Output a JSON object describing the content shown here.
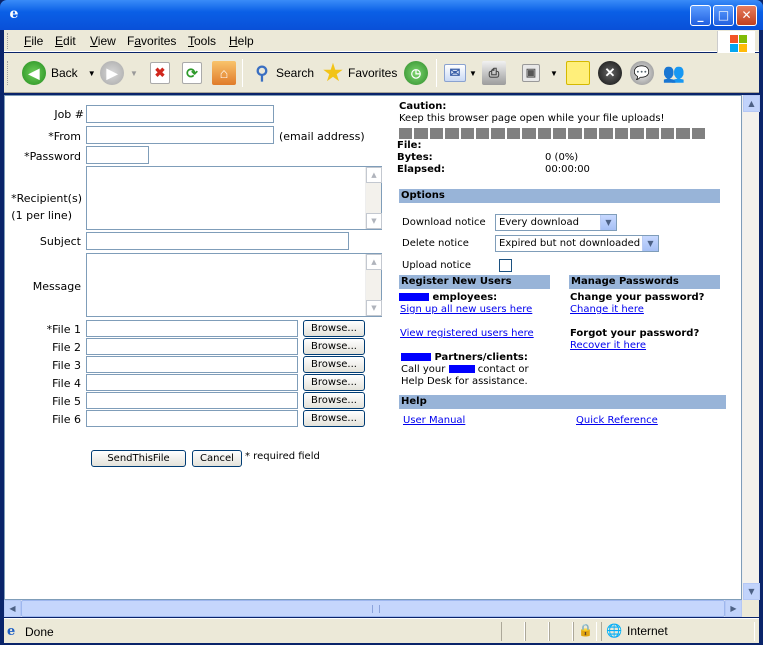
{
  "menu": [
    "File",
    "Edit",
    "View",
    "Favorites",
    "Tools",
    "Help"
  ],
  "menu_accel": [
    "F",
    "E",
    "V",
    "a",
    "T",
    "H"
  ],
  "toolbar": {
    "back": "Back",
    "search": "Search",
    "favorites": "Favorites"
  },
  "form": {
    "job_label": "Job #",
    "from_label": "*From",
    "from_hint": "(email address)",
    "password_label": "*Password",
    "recipients_label": "*Recipient(s)",
    "recipients_hint": "(1 per line)",
    "subject_label": "Subject",
    "message_label": "Message",
    "files": [
      {
        "label": "*File 1",
        "button": "Browse..."
      },
      {
        "label": "File 2",
        "button": "Browse..."
      },
      {
        "label": "File 3",
        "button": "Browse..."
      },
      {
        "label": "File 4",
        "button": "Browse..."
      },
      {
        "label": "File 5",
        "button": "Browse..."
      },
      {
        "label": "File 6",
        "button": "Browse..."
      }
    ],
    "send_button": "SendThisFile",
    "cancel_button": "Cancel",
    "required_note": "* required field"
  },
  "upload": {
    "caution_title": "Caution:",
    "caution_text": "Keep this browser page open while your file uploads!",
    "progress_fraction": 0,
    "file_label": "File:",
    "bytes_label": "Bytes:",
    "bytes_value": "0 (0%)",
    "elapsed_label": "Elapsed:",
    "elapsed_value": "00:00:00"
  },
  "options": {
    "header": "Options",
    "download_label": "Download notice",
    "download_value": "Every download",
    "delete_label": "Delete notice",
    "delete_value": "Expired but not downloaded",
    "upload_label": "Upload notice"
  },
  "register": {
    "header": "Register New Users",
    "employees": "employees:",
    "signup_link": "Sign up all new users here",
    "view_link": "View registered users here",
    "partners": "Partners/clients:",
    "call_prefix": "Call your",
    "call_suffix": "contact or",
    "help_desk": "Help Desk for assistance."
  },
  "passwords": {
    "header": "Manage Passwords",
    "change_q": "Change your password?",
    "change_link": "Change it here",
    "forgot_q": "Forgot your password?",
    "recover_link": "Recover it here"
  },
  "help": {
    "header": "Help",
    "manual_link": "User Manual",
    "quickref_link": "Quick Reference"
  },
  "status": {
    "text": "Done",
    "zone": "Internet"
  },
  "colors": {
    "section_header": "#98B4D8",
    "link": "#0000EE",
    "redaction": "#0000FF",
    "titlebar": "#0A5FE6"
  }
}
